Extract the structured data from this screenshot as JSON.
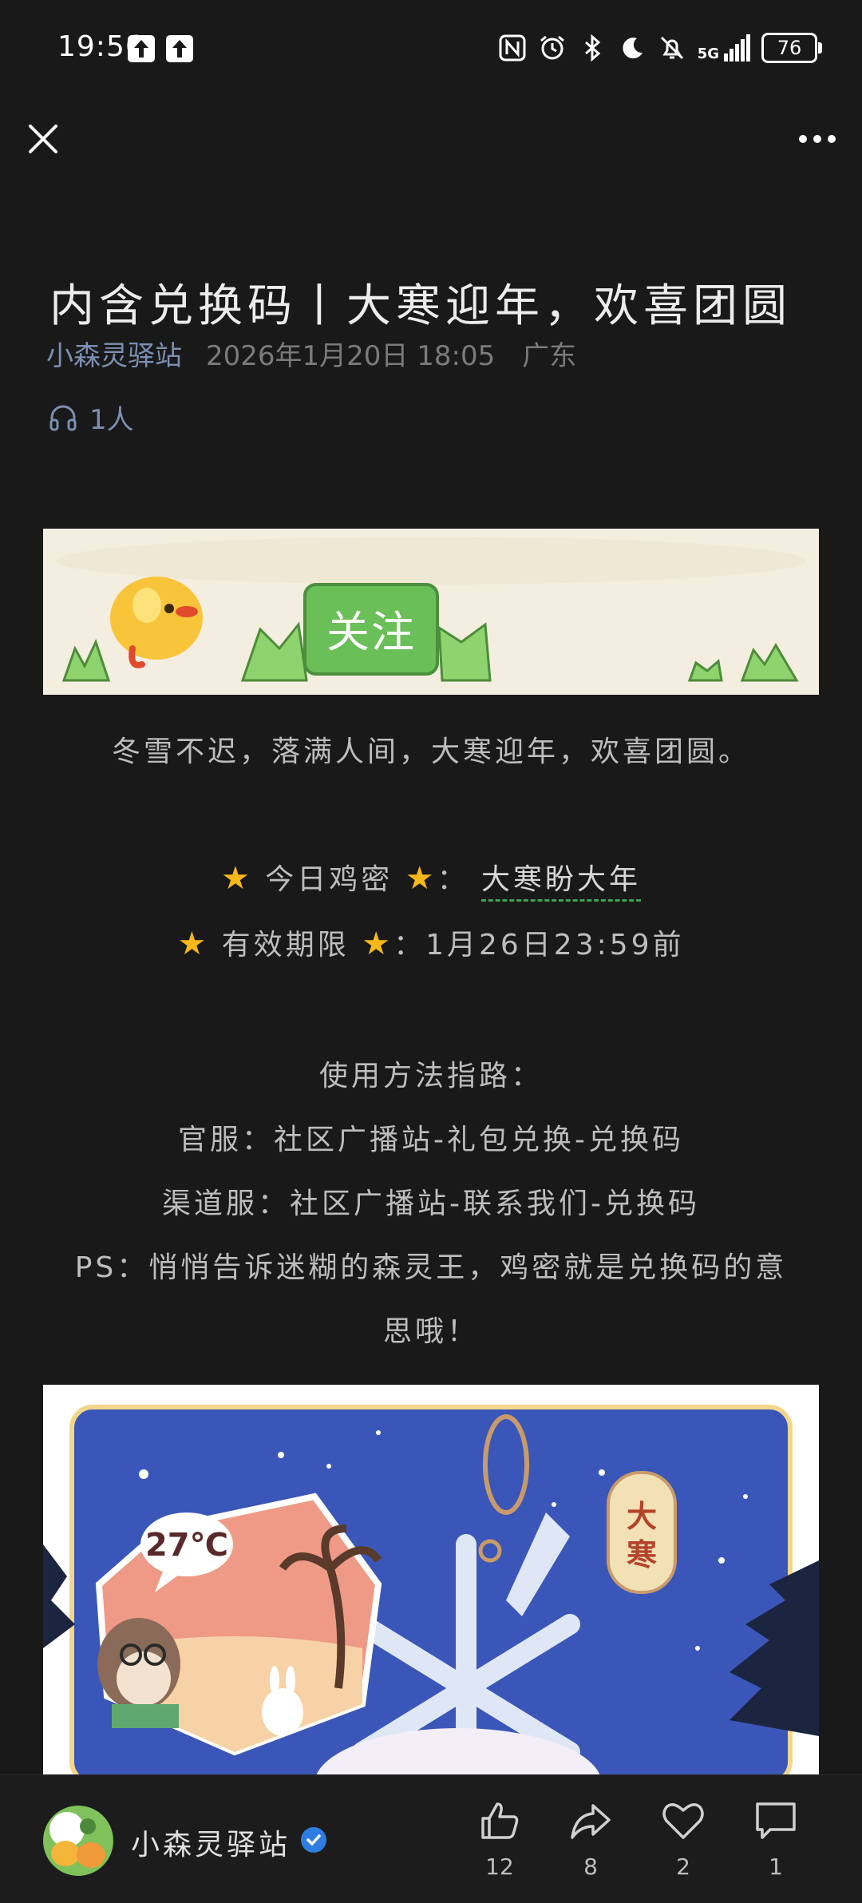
{
  "status_bar": {
    "time": "19:56",
    "network": "5G",
    "battery": "76",
    "icons": [
      "upload-icon",
      "upload-icon",
      "nfc-icon",
      "alarm-icon",
      "bluetooth-icon",
      "moon-icon",
      "mute-bell-icon",
      "signal-icon",
      "battery-icon"
    ]
  },
  "nav": {
    "close_icon": "close-icon",
    "more_icon": "more-icon"
  },
  "article": {
    "title": "内含兑换码丨大寒迎年，欢喜团圆",
    "author": "小森灵驿站",
    "date": "2026年1月20日 18:05",
    "location": "广东",
    "listeners": "1人",
    "follow_label": "关注",
    "intro": "冬雪不迟，落满人间，大寒迎年，欢喜团圆。",
    "password_label": "今日鸡密",
    "password_sep": "：",
    "password_value": "大寒盼大年",
    "validity_label": "有效期限",
    "validity_value": "：1月26日23:59前",
    "guide_title": "使用方法指路：",
    "guide_official": "官服：社区广播站-礼包兑换-兑换码",
    "guide_channel": "渠道服：社区广播站-联系我们-兑换码",
    "ps_line1": "PS：悄悄告诉迷糊的森灵王，鸡密就是兑换码的意",
    "ps_line2": "思哦！",
    "art_temp": "27℃",
    "art_tag": "大寒"
  },
  "bottom_bar": {
    "author": "小森灵驿站",
    "like_count": "12",
    "share_count": "8",
    "favorite_count": "2",
    "comment_count": "1"
  }
}
